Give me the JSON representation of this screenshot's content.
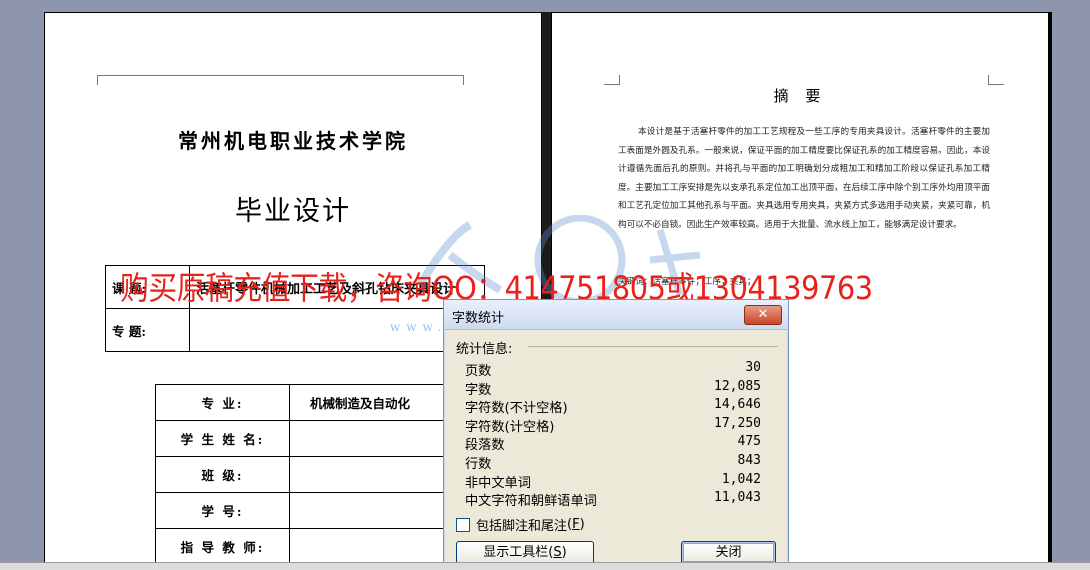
{
  "document": {
    "left_page": {
      "school_name": "常州机电职业技术学院",
      "thesis_title": "毕业设计",
      "topic_table": [
        {
          "label": "课   题:",
          "value": "活塞杆零件机械加工工艺及斜孔钻床夹具设计"
        },
        {
          "label": "专   题:",
          "value": ""
        }
      ],
      "info_table": [
        {
          "label": "专        业:",
          "value": "机械制造及自动化"
        },
        {
          "label": "学 生 姓 名:",
          "value": ""
        },
        {
          "label": "班        级:",
          "value": ""
        },
        {
          "label": "学        号:",
          "value": ""
        },
        {
          "label": "指 导 教 师:",
          "value": ""
        }
      ]
    },
    "right_page": {
      "abstract_title": "摘 要",
      "abstract_body": "本设计是基于活塞杆零件的加工工艺规程及一些工序的专用夹具设计。活塞杆零件的主要加工表面是外圆及孔系。一般来说，保证平面的加工精度要比保证孔系的加工精度容易。因此，本设计遵循先面后孔的原则。并将孔与平面的加工明确划分成粗加工和精加工阶段以保证孔系加工精度。主要加工工序安排是先以支承孔系定位加工出顶平面，在后续工序中除个别工序外均用顶平面和工艺孔定位加工其他孔系与平面。夹具选用专用夹具，夹紧方式多选用手动夹紧，夹紧可靠，机构可以不必自锁。因此生产效率较高。适用于大批量、流水线上加工，能够满足设计要求。",
      "keywords": "关键词：活塞杆零件；工序；夹具；"
    }
  },
  "watermark": {
    "text": "购买原稿充值下载，咨询QQ：414751805或1304139763",
    "url": "www.renrendoc.com"
  },
  "dialog": {
    "title": "字数统计",
    "close_symbol": "✕",
    "stats_header": "统计信息:",
    "stats": [
      {
        "label": "页数",
        "value": "30"
      },
      {
        "label": "字数",
        "value": "12,085"
      },
      {
        "label": "字符数(不计空格)",
        "value": "14,646"
      },
      {
        "label": "字符数(计空格)",
        "value": "17,250"
      },
      {
        "label": "段落数",
        "value": "475"
      },
      {
        "label": "行数",
        "value": "843"
      },
      {
        "label": "非中文单词",
        "value": "1,042"
      },
      {
        "label": "中文字符和朝鲜语单词",
        "value": "11,043"
      }
    ],
    "footnote_label": "包括脚注和尾注",
    "footnote_hotkey": "F",
    "footnote_checked": false,
    "show_toolbar_label": "显示工具栏",
    "show_toolbar_hotkey": "S",
    "close_label": "关闭"
  }
}
